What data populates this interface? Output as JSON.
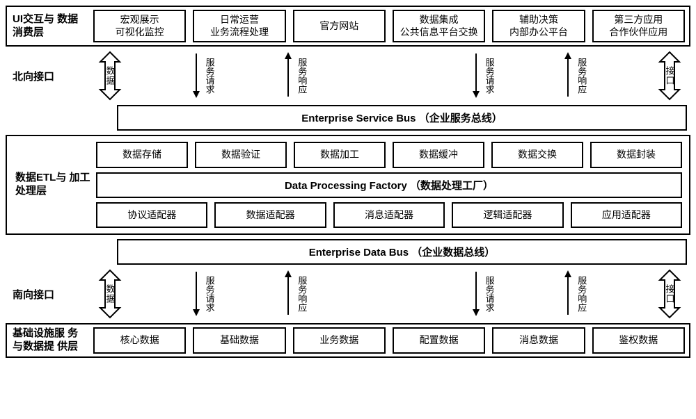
{
  "ui_layer": {
    "title": "UI交互与\n数据消费层",
    "items": [
      "宏观展示\n可视化监控",
      "日常运营\n业务流程处理",
      "官方网站",
      "数据集成\n公共信息平台交换",
      "辅助决策\n内部办公平台",
      "第三方应用\n合作伙伴应用"
    ]
  },
  "north": {
    "title": "北向接口",
    "big1": "数据",
    "req1": "服务请求",
    "resp1": "服务响应",
    "req2": "服务请求",
    "resp2": "服务响应",
    "big2": "接口"
  },
  "esb": "Enterprise Service Bus （企业服务总线）",
  "etl_layer": {
    "title": "数据ETL与\n加工处理层",
    "top": [
      "数据存储",
      "数据验证",
      "数据加工",
      "数据缓冲",
      "数据交换",
      "数据封装"
    ],
    "mid": "Data Processing Factory （数据处理工厂）",
    "bottom": [
      "协议适配器",
      "数据适配器",
      "消息适配器",
      "逻辑适配器",
      "应用适配器"
    ]
  },
  "edb": "Enterprise Data Bus （企业数据总线）",
  "south": {
    "title": "南向接口",
    "big1": "数据",
    "req1": "服务请求",
    "resp1": "服务响应",
    "req2": "服务请求",
    "resp2": "服务响应",
    "big2": "接口"
  },
  "infra_layer": {
    "title": "基础设施服\n务与数据提\n供层",
    "items": [
      "核心数据",
      "基础数据",
      "业务数据",
      "配置数据",
      "消息数据",
      "鉴权数据"
    ]
  }
}
